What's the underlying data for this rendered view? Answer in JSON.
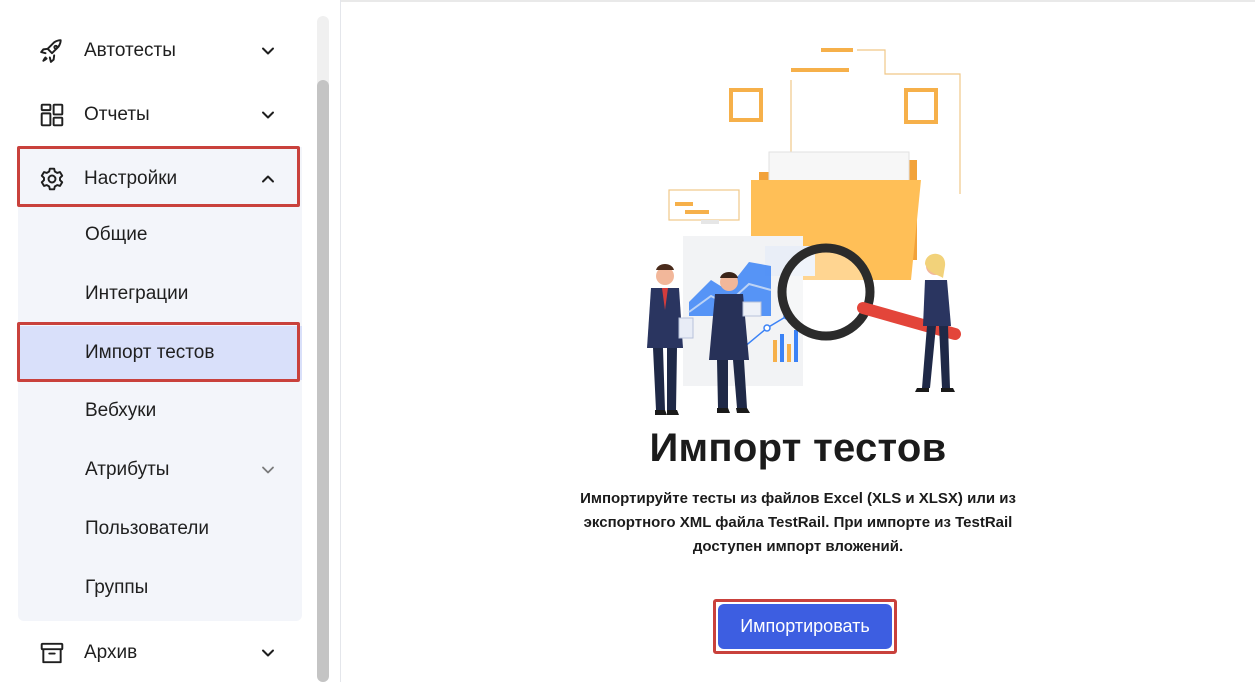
{
  "sidebar": {
    "items": [
      {
        "label": "Автотесты",
        "icon": "rocket-icon",
        "chevron": "chevron-down-icon"
      },
      {
        "label": "Отчеты",
        "icon": "dashboard-icon",
        "chevron": "chevron-down-icon"
      },
      {
        "label": "Настройки",
        "icon": "gear-icon",
        "chevron": "chevron-up-icon"
      }
    ],
    "settings_sub": [
      {
        "label": "Общие"
      },
      {
        "label": "Интеграции"
      },
      {
        "label": "Импорт тестов",
        "active": true
      },
      {
        "label": "Вебхуки"
      },
      {
        "label": "Атрибуты",
        "chevron": "chevron-down-icon"
      },
      {
        "label": "Пользователи"
      },
      {
        "label": "Группы"
      }
    ],
    "archive": {
      "label": "Архив",
      "icon": "archive-icon",
      "chevron": "chevron-down-icon"
    }
  },
  "main": {
    "illustration": "import-folder-illustration",
    "title": "Импорт тестов",
    "description_lines": [
      "Импортируйте тесты из файлов Excel (XLS и XLSX) или из",
      "экспортного XML файла TestRail. При импорте из TestRail",
      "доступен импорт вложений."
    ],
    "import_button": "Импортировать"
  },
  "colors": {
    "accent": "#3d5ee1",
    "active_bg": "#d9e0fa",
    "submenu_bg": "#f3f5fa",
    "highlight": "#c9413c",
    "folder": "#ffb74a"
  }
}
